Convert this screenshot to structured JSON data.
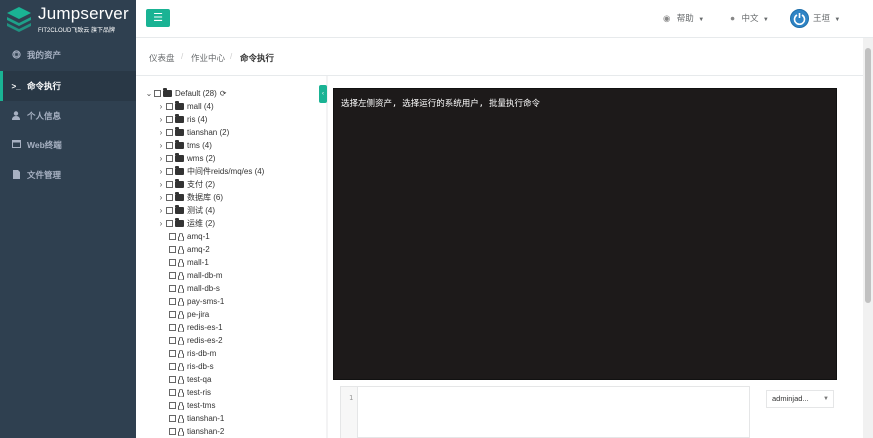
{
  "brand": {
    "title": "Jumpserver",
    "subtitle": "FIT2CLOUD飞致云 旗下品牌"
  },
  "sidebar": {
    "items": [
      {
        "label": "我的资产",
        "icon": "cube-icon",
        "active": false
      },
      {
        "label": "命令执行",
        "icon": "terminal-icon",
        "active": true
      },
      {
        "label": "个人信息",
        "icon": "user-icon",
        "active": false
      },
      {
        "label": "Web终端",
        "icon": "window-icon",
        "active": false
      },
      {
        "label": "文件管理",
        "icon": "file-icon",
        "active": false
      }
    ]
  },
  "topbar": {
    "help_label": "帮助",
    "lang_label": "中文",
    "user_label": "王垣"
  },
  "breadcrumb": [
    "仪表盘",
    "作业中心",
    "命令执行"
  ],
  "tree": {
    "root_label": "Default (28)",
    "groups": [
      "mall (4)",
      "ris (4)",
      "tianshan (2)",
      "tms (4)",
      "wms (2)",
      "中间件reids/mq/es (4)",
      "支付 (2)",
      "数据库 (6)",
      "测试 (4)",
      "运维 (2)"
    ],
    "assets": [
      "amq-1",
      "amq-2",
      "mall-1",
      "mall-db-m",
      "mall-db-s",
      "pay-sms-1",
      "pe-jira",
      "redis-es-1",
      "redis-es-2",
      "ris-db-m",
      "ris-db-s",
      "test-qa",
      "test-ris",
      "test-tms",
      "tianshan-1",
      "tianshan-2"
    ]
  },
  "terminal": {
    "message": "选择左侧资产, 选择运行的系统用户, 批量执行命令"
  },
  "editor": {
    "line_number": "1"
  },
  "system_user": {
    "selected": "adminjad..."
  },
  "colors": {
    "sidebar": "#2f4050",
    "accent": "#1ab394",
    "terminal_bg": "#1d1a1a"
  }
}
